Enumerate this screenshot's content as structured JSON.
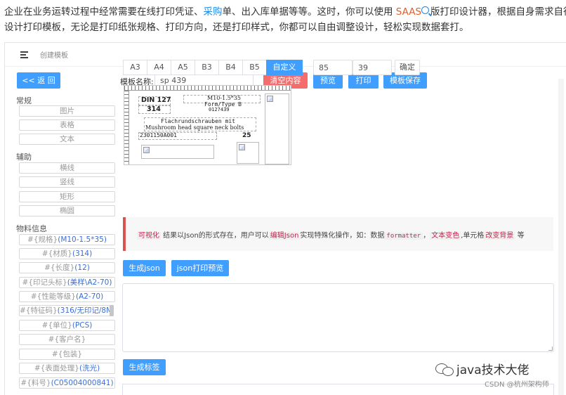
{
  "intro": {
    "line1_a": "企业在业务运转过程中经常需要在线打印凭证、",
    "line1_link": "采购",
    "line1_b": "单、出入库单据等等。这时，你可以使用 ",
    "line1_saas": "SAAS",
    "line1_c": "版打印设计器，根据自身需求自行",
    "line2": "设计打印模板，无论是打印纸张规格、打印方向，还是打印样式，你都可以自由调整设计，轻松实现数据套打。"
  },
  "topbar": {
    "crumb": "创建模板"
  },
  "toolbar": {
    "back": "<< 返 回",
    "template_name_label": "模板名称:",
    "template_name_value": "sp 439",
    "clear": "清空内容",
    "preview": "预览",
    "print": "打印",
    "save": "模板保存"
  },
  "paper": {
    "sizes": [
      "A3",
      "A4",
      "A5",
      "B3",
      "B4",
      "B5",
      "自定义"
    ],
    "width": "85",
    "height": "39",
    "confirm": "确定"
  },
  "sidebar": {
    "groups": {
      "common": "常规",
      "aux": "辅助",
      "material": "物料信息"
    },
    "common_items": [
      "图片",
      "表格",
      "文本"
    ],
    "aux_items": [
      "横线",
      "竖线",
      "矩形",
      "椭圆"
    ],
    "material_items": [
      {
        "key": "#{规格}",
        "val": "(M10-1.5*35)"
      },
      {
        "key": "#{材质}",
        "val": "(314)"
      },
      {
        "key": "#{长度}",
        "val": "(12)"
      },
      {
        "key": "#{印记头标}",
        "val": "(美样\\A2-70)"
      },
      {
        "key": "#{性能等级}",
        "val": "(A2-70)"
      },
      {
        "key": "#{特征码}",
        "val": "(316/无印记/8M/"
      },
      {
        "key": "#{单位}",
        "val": "(PCS)"
      },
      {
        "key": "#{客户名}",
        "val": ""
      },
      {
        "key": "#{包装}",
        "val": ""
      },
      {
        "key": "#{表面处理}",
        "val": "(洗光)"
      },
      {
        "key": "#{料号}",
        "val": "(C05004000841)"
      }
    ]
  },
  "canvas": {
    "din": "DIN 127",
    "din_num": "314",
    "spec": "M10-1.5*35",
    "form": "Form/Type B",
    "code": "0127439",
    "de_text": "Flachrundschrauben mit",
    "en_text": "Mushroom head square neck bolts",
    "batch": "2301150A001",
    "qty": "25"
  },
  "tip": {
    "tag1": "可视化",
    "text1": " 结果以Json的形式存在，用户可以",
    "tag2": "编辑Json",
    "text2": "实现特殊化操作，如：数据",
    "tag3": "formatter",
    "text3": "，",
    "tag4": "文本变色",
    "text4": ",单元格",
    "tag5": "改变背景",
    "text5": " 等"
  },
  "actions": {
    "gen_json": "生成json",
    "json_preview": "json打印预览",
    "gen_label": "生成标签"
  },
  "watermark": {
    "text": "java技术大佬",
    "csdn": "CSDN @杭州架构师"
  }
}
